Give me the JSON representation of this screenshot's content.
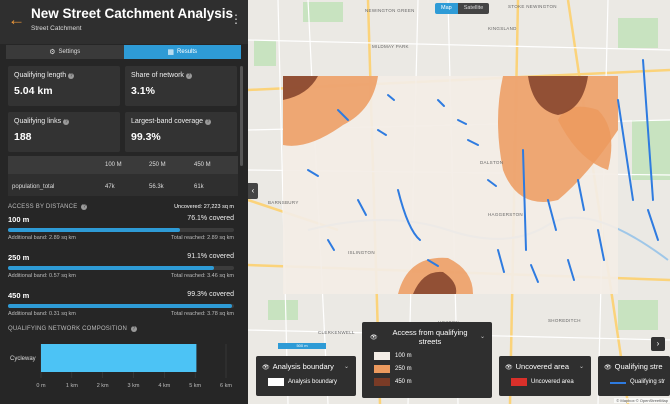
{
  "header": {
    "title": "New Street Catchment Analysis",
    "subtitle": "Street Catchment"
  },
  "tabs": {
    "settings": "Settings",
    "results": "Results"
  },
  "metrics": {
    "qualifying_length": {
      "label": "Qualifying length",
      "value": "5.04 km"
    },
    "share_of_network": {
      "label": "Share of network",
      "value": "3.1%"
    },
    "qualifying_links": {
      "label": "Qualifying links",
      "value": "188"
    },
    "largest_band_coverage": {
      "label": "Largest-band coverage",
      "value": "99.3%"
    }
  },
  "population_table": {
    "columns": [
      "100 M",
      "250 M",
      "450 M"
    ],
    "row_label": "population_total",
    "values": [
      "47k",
      "56.3k",
      "61k"
    ]
  },
  "access": {
    "section_label": "ACCESS BY DISTANCE",
    "uncovered_summary": "Uncovered: 27,223 sq m",
    "bands": [
      {
        "name": "100 m",
        "covered": "76.1% covered",
        "fraction": 0.761,
        "additional": "Additional band: 2.89 sq km",
        "total": "Total reached: 2.89 sq km"
      },
      {
        "name": "250 m",
        "covered": "91.1% covered",
        "fraction": 0.911,
        "additional": "Additional band: 0.57 sq km",
        "total": "Total reached: 3.46 sq km"
      },
      {
        "name": "450 m",
        "covered": "99.3% covered",
        "fraction": 0.993,
        "additional": "Additional band: 0.31 sq km",
        "total": "Total reached: 3.78 sq km"
      }
    ]
  },
  "composition": {
    "section_label": "QUALIFYING NETWORK COMPOSITION"
  },
  "chart_data": {
    "type": "bar",
    "orientation": "horizontal",
    "categories": [
      "Cycleway"
    ],
    "values": [
      5.04
    ],
    "xlim": [
      0,
      6
    ],
    "xticks": [
      "0 m",
      "1 km",
      "2 km",
      "3 km",
      "4 km",
      "5 km",
      "6 km"
    ],
    "color": "#4cc3f5"
  },
  "map": {
    "toggle": {
      "map": "Map",
      "satellite": "Satellite"
    },
    "scale": "500 m",
    "attribution": "© Mapbox © OpenStreetMap",
    "labels": [
      "NEWINGTON GREEN",
      "MILDMAY PARK",
      "DALSTON",
      "KINGSLAND",
      "HAGGERSTON",
      "HOXTON",
      "ISLINGTON",
      "BARNSBURY",
      "STOKE NEWINGTON",
      "CLERKENWELL",
      "SHOREDITCH"
    ],
    "colors": {
      "band_100": "#f3ede6",
      "band_250": "#ec9a5e",
      "band_450": "#7a3b26",
      "street": "#2e7be0"
    }
  },
  "legends": {
    "boundary": {
      "title": "Analysis boundary",
      "item": "Analysis boundary"
    },
    "access": {
      "title": "Access from qualifying streets",
      "items": [
        "100 m",
        "250 m",
        "450 m"
      ]
    },
    "uncovered": {
      "title": "Uncovered area",
      "item": "Uncovered area"
    },
    "qualifying": {
      "title": "Qualifying stre",
      "item": "Qualifying str"
    }
  }
}
